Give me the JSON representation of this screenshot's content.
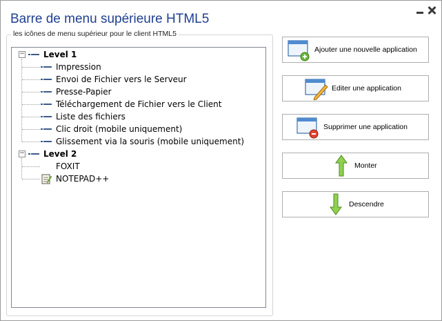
{
  "window": {
    "title": "Barre de menu supérieure HTML5"
  },
  "group": {
    "legend": "les icônes de menu supérieur pour le client HTML5"
  },
  "tree": {
    "levels": [
      {
        "label": "Level 1",
        "expanded": true,
        "items": [
          {
            "label": "Impression",
            "icon": "menu-line-icon"
          },
          {
            "label": "Envoi de Fichier vers le Serveur",
            "icon": "menu-line-icon"
          },
          {
            "label": "Presse-Papier",
            "icon": "menu-line-icon"
          },
          {
            "label": "Téléchargement de Fichier vers le Client",
            "icon": "menu-line-icon"
          },
          {
            "label": "Liste des fichiers",
            "icon": "menu-line-icon"
          },
          {
            "label": "Clic droit (mobile uniquement)",
            "icon": "menu-line-icon"
          },
          {
            "label": "Glissement via la souris (mobile uniquement)",
            "icon": "menu-line-icon"
          }
        ]
      },
      {
        "label": "Level 2",
        "expanded": true,
        "items": [
          {
            "label": "FOXIT",
            "icon": ""
          },
          {
            "label": "NOTEPAD++",
            "icon": "notepad-icon"
          }
        ]
      }
    ]
  },
  "buttons": {
    "add": "Ajouter une nouvelle application",
    "edit": "Editer une application",
    "delete": "Supprimer une application",
    "up": "Monter",
    "down": "Descendre"
  },
  "colors": {
    "title": "#1f3f8f",
    "accent_green": "#7cc242",
    "delete_red": "#e0452f"
  }
}
